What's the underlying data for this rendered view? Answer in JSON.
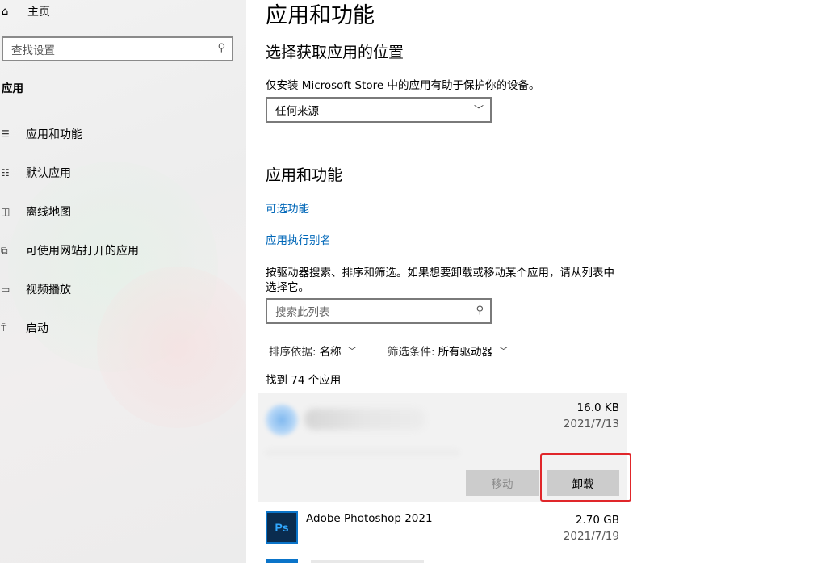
{
  "sidebar": {
    "home_label": "主页",
    "search_placeholder": "查找设置",
    "section_title": "应用",
    "items": [
      {
        "label": "应用和功能",
        "icon": "apps-list-icon"
      },
      {
        "label": "默认应用",
        "icon": "default-apps-icon"
      },
      {
        "label": "离线地图",
        "icon": "map-icon"
      },
      {
        "label": "可使用网站打开的应用",
        "icon": "open-website-icon"
      },
      {
        "label": "视频播放",
        "icon": "video-icon"
      },
      {
        "label": "启动",
        "icon": "startup-icon"
      }
    ]
  },
  "main": {
    "title": "应用和功能",
    "install_heading": "选择获取应用的位置",
    "install_note": "仅安装 Microsoft Store 中的应用有助于保护你的设备。",
    "source_selected": "任何来源",
    "apps_heading": "应用和功能",
    "link_optional": "可选功能",
    "link_alias": "应用执行别名",
    "search_hint_line1": "按驱动器搜索、排序和筛选。如果想要卸载或移动某个应用，请从列表中",
    "search_hint_line2": "选择它。",
    "list_search_placeholder": "搜索此列表",
    "sort_label": "排序依据:",
    "sort_value": "名称",
    "filter_label": "筛选条件:",
    "filter_value": "所有驱动器",
    "count_text": "找到 74 个应用",
    "apps": [
      {
        "name": "",
        "size": "16.0 KB",
        "date": "2021/7/13",
        "move_label": "移动",
        "uninstall_label": "卸载"
      },
      {
        "name": "Adobe Photoshop 2021",
        "size": "2.70 GB",
        "date": "2021/7/19",
        "icon_text": "Ps"
      }
    ]
  },
  "colors": {
    "link": "#0067b8",
    "highlight": "#e0262a",
    "ps_bg": "#0a2c4f",
    "ps_text": "#31a8ff"
  }
}
